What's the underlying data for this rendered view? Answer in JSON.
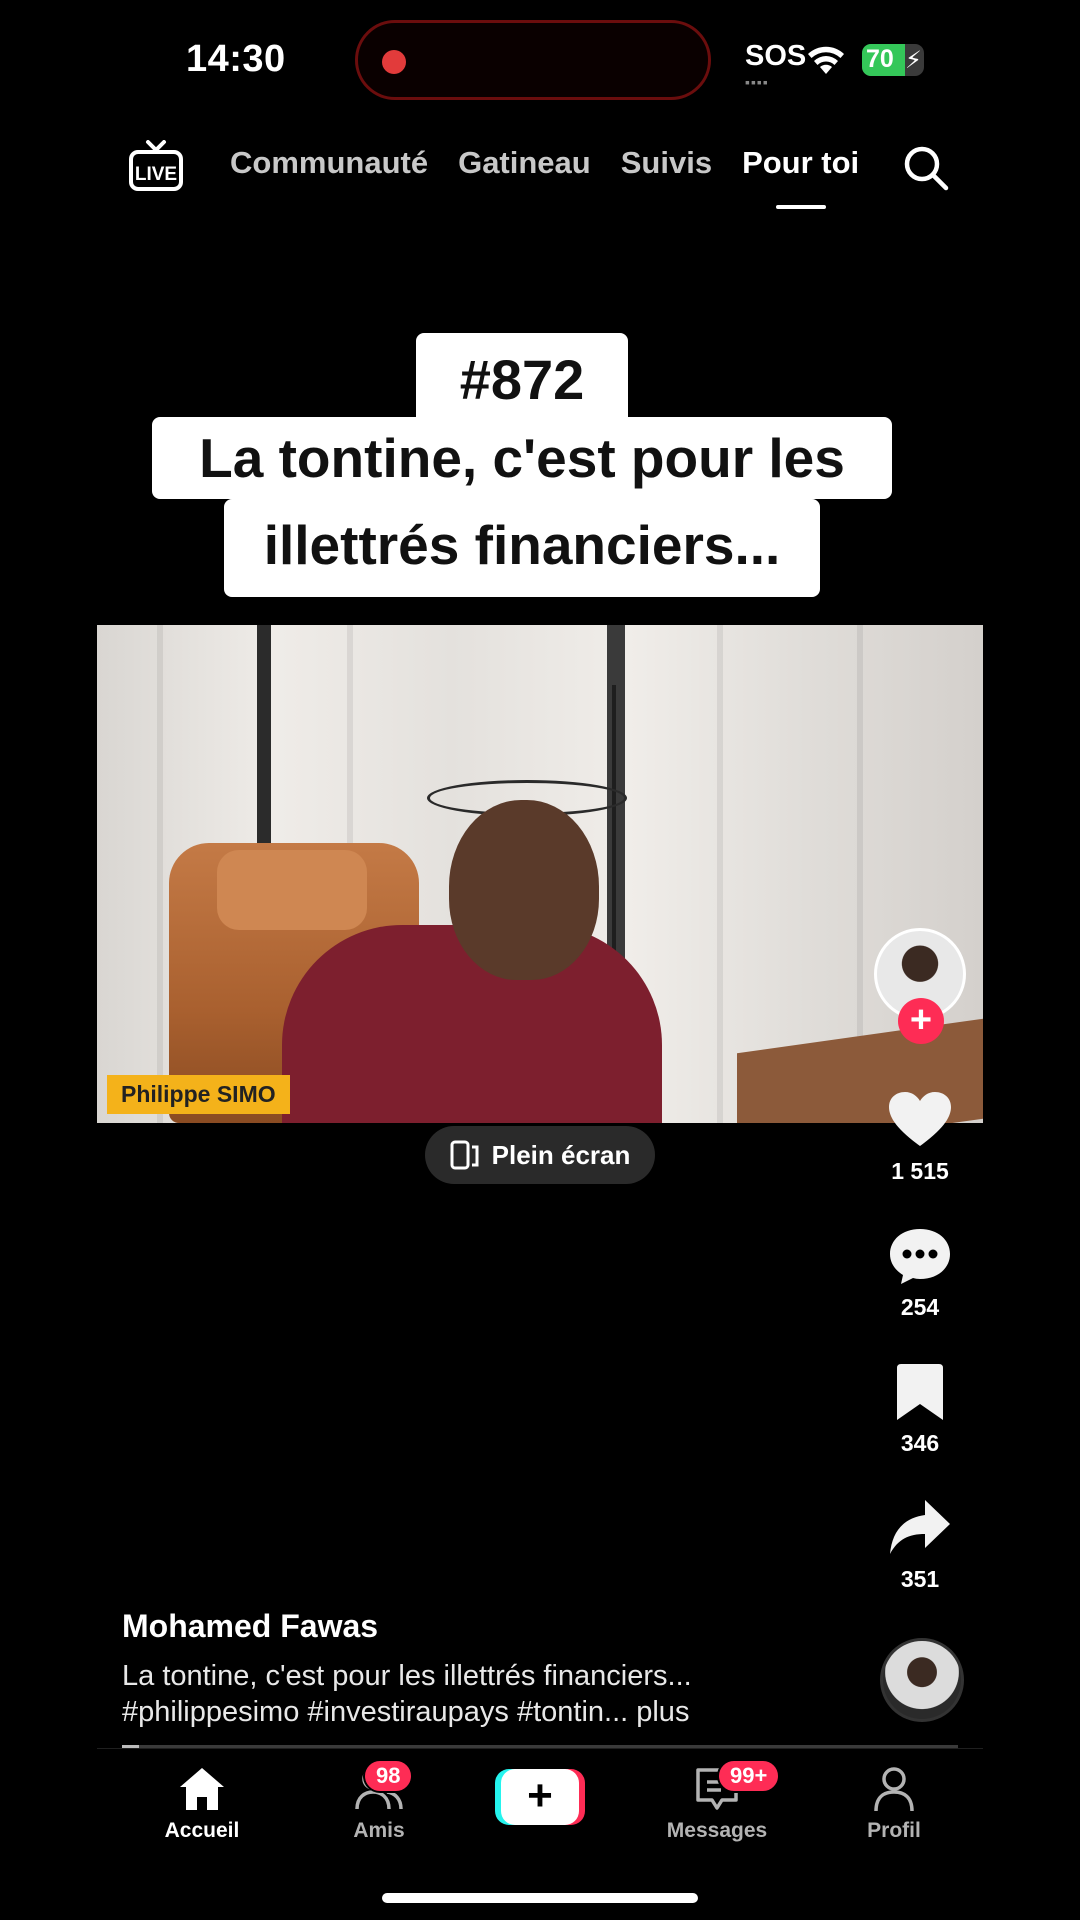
{
  "status_bar": {
    "time": "14:30",
    "sos": "SOS",
    "battery_level": "70",
    "battery_fraction": 0.7,
    "recording_dot_color": "#e23b3b"
  },
  "top_nav": {
    "live_label": "LIVE",
    "tabs": [
      {
        "label": "Communauté",
        "active": false
      },
      {
        "label": "Gatineau",
        "active": false
      },
      {
        "label": "Suivis",
        "active": false
      },
      {
        "label": "Pour toi",
        "active": true
      }
    ],
    "search_icon": "search-icon"
  },
  "video": {
    "overlay_number": "#872",
    "overlay_line1": "La tontine, c'est pour les",
    "overlay_line2": "illettrés financiers...",
    "name_tag": "Philippe SIMO",
    "fullscreen_label": "Plein écran"
  },
  "actions": {
    "likes": "1 515",
    "comments": "254",
    "saves": "346",
    "shares": "351"
  },
  "post": {
    "author": "Mohamed Fawas",
    "description_line1": "La tontine, c'est pour les illettrés financiers...",
    "description_line2": "#philippesimo #investiraupays #tontin... plus",
    "progress_fraction": 0.02
  },
  "bottom_nav": {
    "items": [
      {
        "label": "Accueil",
        "icon": "home-icon",
        "active": true
      },
      {
        "label": "Amis",
        "icon": "friends-icon",
        "badge": "98"
      },
      {
        "label": "",
        "icon": "create-icon"
      },
      {
        "label": "Messages",
        "icon": "messages-icon",
        "badge": "99+"
      },
      {
        "label": "Profil",
        "icon": "profile-icon"
      }
    ]
  },
  "colors": {
    "accent": "#fe2c55",
    "create_left": "#25f4ee",
    "name_tag": "#f4b21a",
    "battery": "#34c759"
  }
}
